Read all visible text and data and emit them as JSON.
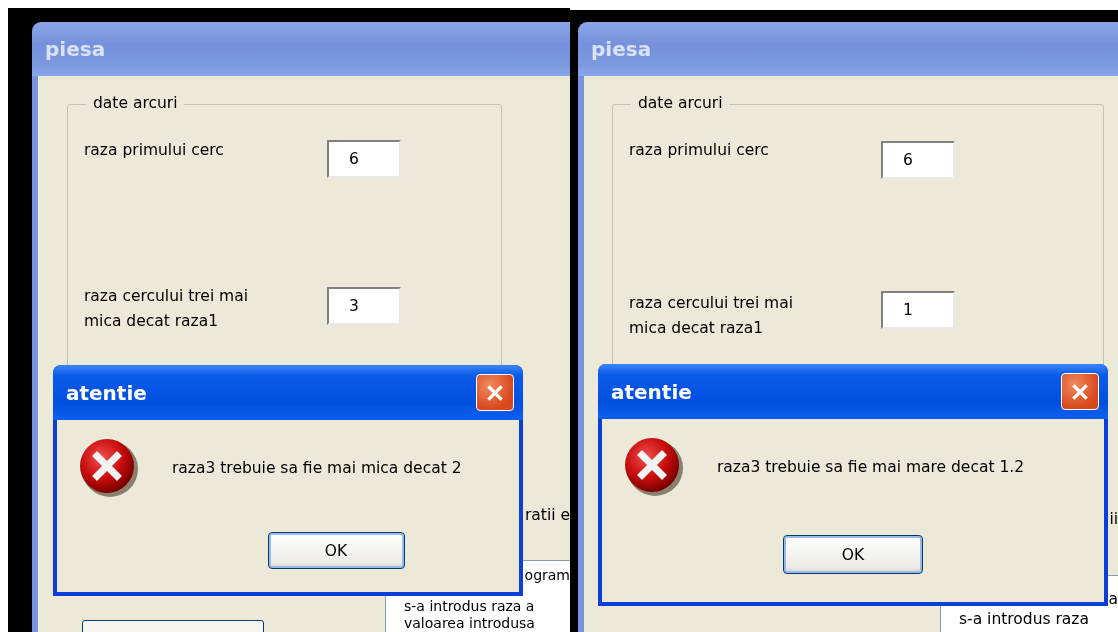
{
  "panels": [
    {
      "window": {
        "title": "piesa"
      },
      "group": {
        "legend": "date arcuri",
        "fields": [
          {
            "label": "raza primului cerc",
            "value": "6"
          },
          {
            "label": "raza cercului trei mai mica decat raza1",
            "value": "3"
          }
        ]
      },
      "covered_label": "ratii e",
      "text_area": {
        "lines": [
          {
            "text": "ogram",
            "covered": true
          },
          {
            "text": "s-a introdus raza a",
            "covered": false
          },
          {
            "text": "valoarea introdusa",
            "covered": false
          }
        ]
      },
      "bottom_button": true,
      "dialog": {
        "title": "atentie",
        "message": "raza3 trebuie sa fie mai mica decat 2",
        "button": "OK"
      }
    },
    {
      "window": {
        "title": "piesa"
      },
      "group": {
        "legend": "date arcuri",
        "fields": [
          {
            "label": "raza primului cerc",
            "value": "6"
          },
          {
            "label": "raza cercului trei mai mica decat raza1",
            "value": "1"
          }
        ]
      },
      "covered_label": "ii",
      "text_area": {
        "lines": [
          {
            "text": "a",
            "covered": true
          },
          {
            "text": "s-a introdus raza",
            "covered": false
          }
        ]
      },
      "bottom_button": false,
      "dialog": {
        "title": "atentie",
        "message": "raza3 trebuie sa fie mai mare decat 1.2",
        "button": "OK"
      }
    }
  ]
}
